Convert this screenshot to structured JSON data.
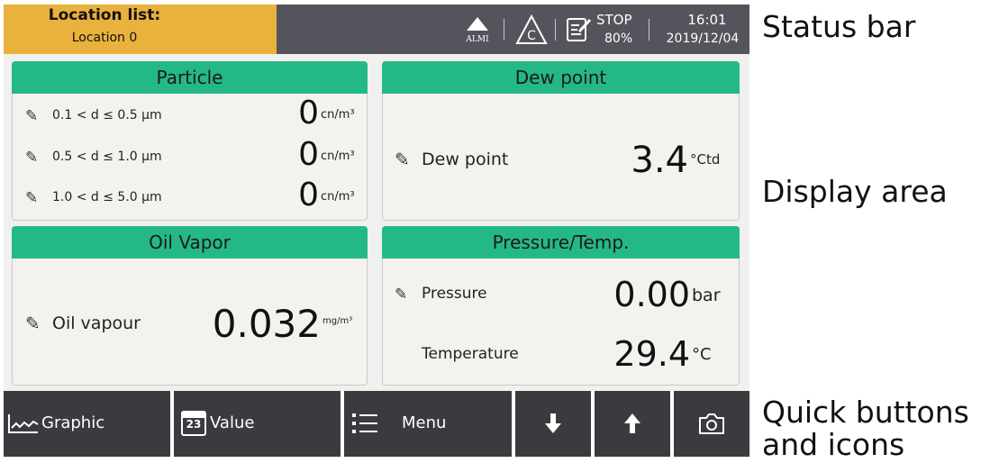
{
  "status_bar": {
    "location_title": "Location list:",
    "location_value": "Location 0",
    "alarm_label": "ALMI",
    "run_state": "STOP",
    "memory_percent": "80%",
    "time": "16:01",
    "date": "2019/12/04"
  },
  "panels": {
    "particle": {
      "title": "Particle",
      "rows": [
        {
          "label": "0.1 < d ≤ 0.5 µm",
          "value": "0",
          "unit": "cn/m³"
        },
        {
          "label": "0.5 < d ≤ 1.0 µm",
          "value": "0",
          "unit": "cn/m³"
        },
        {
          "label": "1.0 < d ≤ 5.0 µm",
          "value": "0",
          "unit": "cn/m³"
        }
      ]
    },
    "dew_point": {
      "title": "Dew point",
      "label": "Dew point",
      "value": "3.4",
      "unit": "°Ctd"
    },
    "oil_vapor": {
      "title": "Oil Vapor",
      "label": "Oil vapour",
      "value": "0.032",
      "unit": "mg/m³"
    },
    "pressure_temp": {
      "title": "Pressure/Temp.",
      "pressure_label": "Pressure",
      "pressure_value": "0.00",
      "pressure_unit": "bar",
      "temperature_label": "Temperature",
      "temperature_value": "29.4",
      "temperature_unit": "°C"
    }
  },
  "quick_buttons": {
    "graphic_label": "Graphic",
    "value_label": "Value",
    "value_icon_number": "23",
    "menu_label": "Menu"
  },
  "annotations": {
    "status_bar": "Status bar",
    "display_area": "Display area",
    "quick_buttons_line1": "Quick buttons",
    "quick_buttons_line2": "and icons"
  },
  "colors": {
    "status_bar_bg": "#54555c",
    "location_bg": "#e9b23c",
    "panel_header": "#25b887",
    "quick_button_bg": "#3a3b3f"
  },
  "icons": [
    "alarm-triangle-icon",
    "warning-c-icon",
    "memo-pencil-icon",
    "pencil-icon",
    "graph-icon",
    "calendar-icon",
    "list-icon",
    "arrow-down-icon",
    "arrow-up-icon",
    "camera-icon"
  ]
}
